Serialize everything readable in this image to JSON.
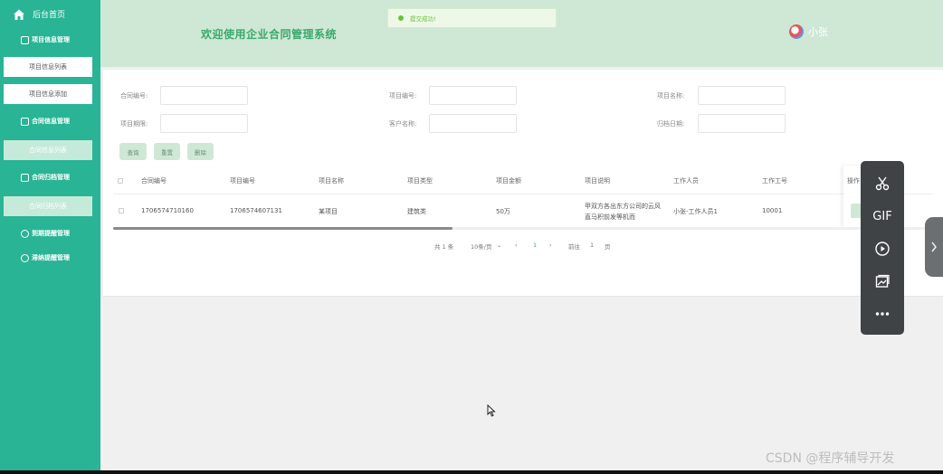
{
  "sidebar": {
    "home_label": "后台首页",
    "groups": [
      {
        "label": "项目信息管理"
      },
      {
        "label": "合同信息管理"
      },
      {
        "label": "合同归档管理"
      },
      {
        "label": "到期提醒管理"
      },
      {
        "label": "滞纳提醒管理"
      }
    ],
    "items": [
      {
        "label": "项目信息列表"
      },
      {
        "label": "项目信息添加"
      },
      {
        "label": "合同信息列表"
      },
      {
        "label": "合同归档列表"
      }
    ]
  },
  "header": {
    "title": "欢迎使用企业合同管理系统",
    "user_name": "小张"
  },
  "toast": {
    "message": "提交成功!"
  },
  "search": {
    "contract_no_label": "合同编号:",
    "project_no_label": "项目编号:",
    "project_name_label": "项目名称:",
    "project_period_label": "项目期限:",
    "customer_name_label": "客户名称:",
    "archive_date_label": "归档日期:",
    "query_label": "查询",
    "reset_label": "重置",
    "delete_label": "删除"
  },
  "table": {
    "headers": [
      "合同编号",
      "项目编号",
      "项目名称",
      "项目类型",
      "项目金额",
      "项目说明",
      "工作人员",
      "工作工号",
      "操作"
    ],
    "rows": [
      {
        "contract_no": "1706574710160",
        "project_no": "1706574607131",
        "project_name": "某项目",
        "project_type": "建筑类",
        "amount": "50万",
        "desc_line1": "甲双方各出东方公司的云风",
        "desc_line2": "直马积前发等机而",
        "staff": "小张-工作人员1",
        "staff_no": "10001"
      }
    ]
  },
  "pagination": {
    "total": "共 1 条",
    "page_size": "10条/页",
    "current": "1",
    "goto_label": "前往",
    "goto_value": "1",
    "page_unit": "页"
  },
  "toolbar": {
    "gif_label": "GIF"
  },
  "watermark": "CSDN @程序辅导开发",
  "colors": {
    "sidebar": "#29b495",
    "header": "#cfe8d6",
    "accent": "#39a96b",
    "toast_text": "#67c23a"
  }
}
